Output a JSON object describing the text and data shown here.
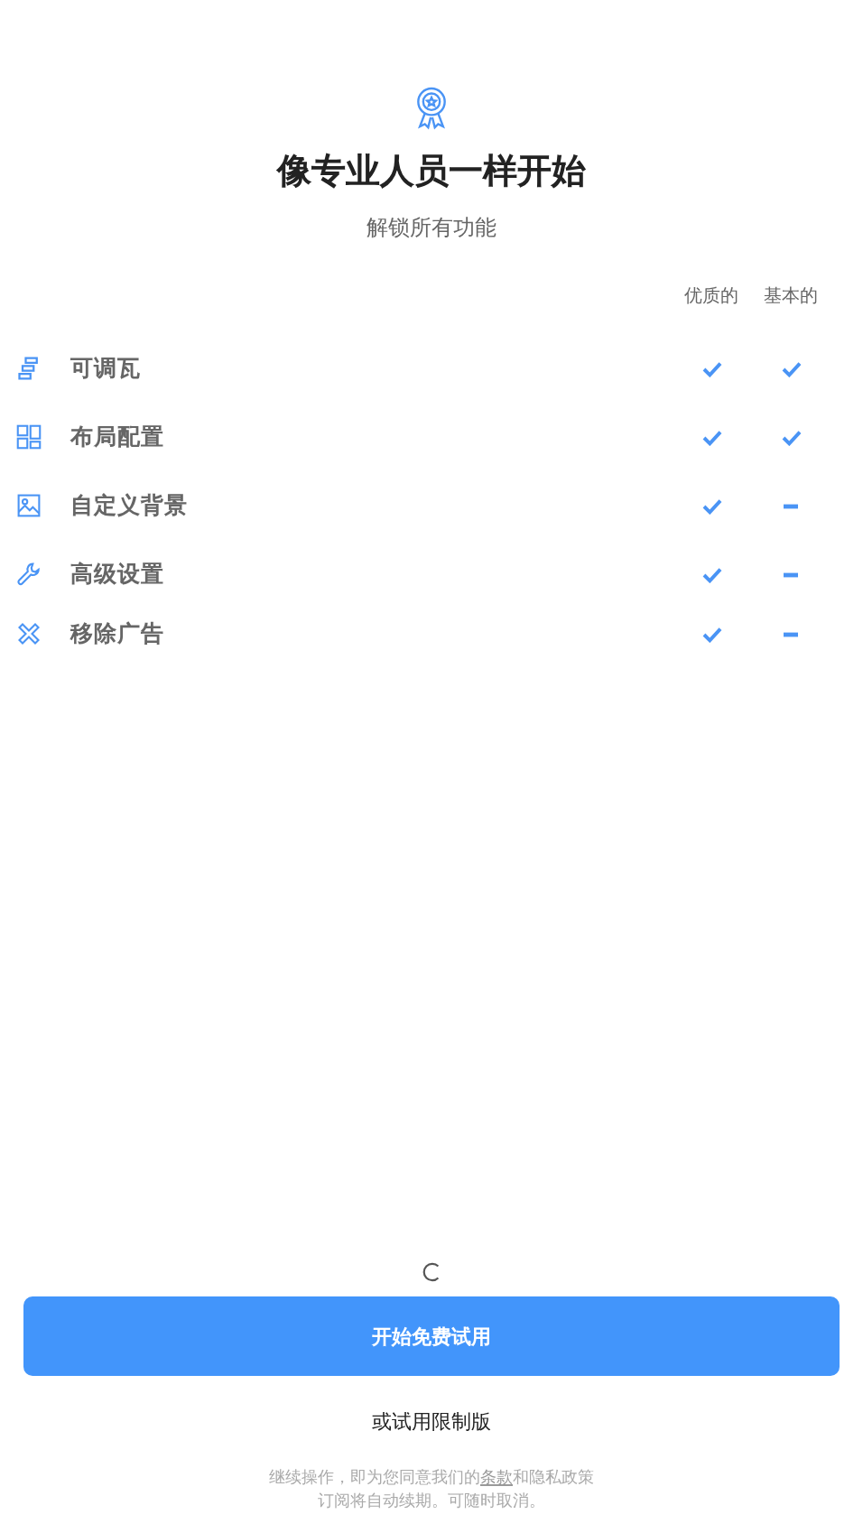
{
  "header": {
    "title": "像专业人员一样开始",
    "subtitle": "解锁所有功能"
  },
  "plans": {
    "columns": [
      "优质的",
      "基本的"
    ]
  },
  "features": [
    {
      "kind": "tiles",
      "label": "可调瓦",
      "premium": true,
      "basic": true
    },
    {
      "kind": "layout",
      "label": "布局配置",
      "premium": true,
      "basic": true
    },
    {
      "kind": "image",
      "label": "自定义背景",
      "premium": true,
      "basic": false
    },
    {
      "kind": "wrench",
      "label": "高级设置",
      "premium": true,
      "basic": false
    },
    {
      "kind": "cross",
      "label": "移除广告",
      "premium": true,
      "basic": false
    }
  ],
  "loading": true,
  "primary_button": "开始免费试用",
  "secondary_link": "或试用限制版",
  "legal": {
    "before": "继续操作，即为您同意我们的",
    "terms_link": "条款",
    "after": "和隐私政策",
    "line2": "订阅将自动续期。可随时取消。"
  }
}
